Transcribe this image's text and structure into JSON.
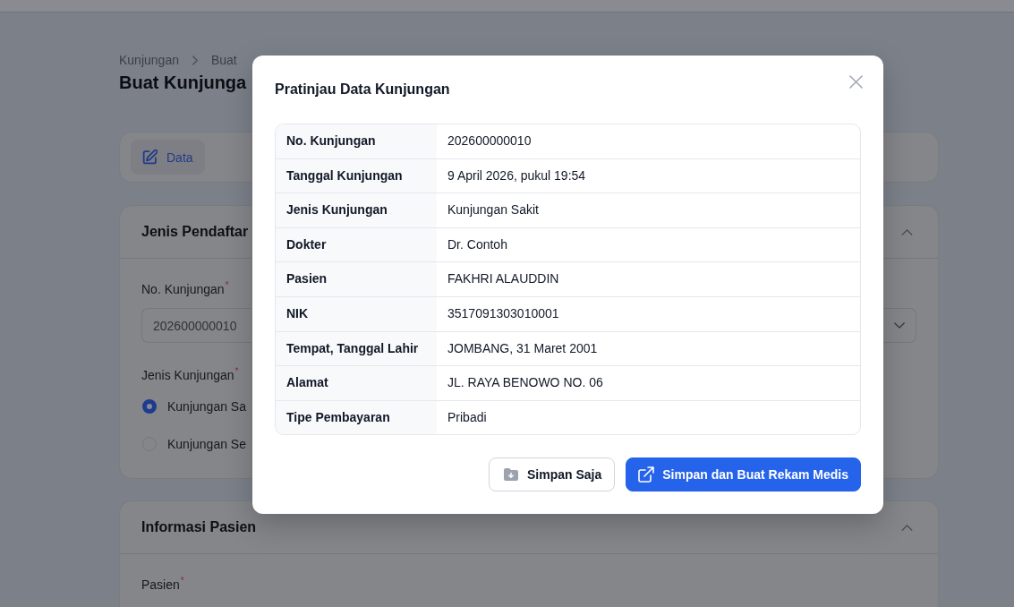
{
  "breadcrumb": [
    {
      "label": "Kunjungan"
    },
    {
      "label": "Buat"
    }
  ],
  "page_title": "Buat Kunjunga",
  "tabs": [
    {
      "label": "Data",
      "selected": true
    }
  ],
  "sections": [
    {
      "title": "Jenis Pendaftar",
      "expanded": true,
      "fields": [
        {
          "kind": "text",
          "label": "No. Kunjungan",
          "required_mark": "*",
          "value": "202600000010"
        },
        {
          "kind": "select"
        },
        {
          "kind": "radio",
          "label": "Jenis Kunjungan",
          "required_mark": "*",
          "options": [
            {
              "label": "Kunjungan Sa",
              "selected": true
            },
            {
              "label": "Kunjungan Se",
              "selected": false
            }
          ]
        }
      ]
    },
    {
      "title": "Informasi Pasien",
      "expanded": true,
      "fields": [
        {
          "kind": "label",
          "label": "Pasien",
          "required_mark": "*"
        }
      ]
    }
  ],
  "modal": {
    "title": "Pratinjau Data Kunjungan",
    "rows": [
      {
        "label": "No. Kunjungan",
        "value": "202600000010"
      },
      {
        "label": "Tanggal Kunjungan",
        "value": "9 April 2026, pukul 19:54"
      },
      {
        "label": "Jenis Kunjungan",
        "value": "Kunjungan Sakit"
      },
      {
        "label": "Dokter",
        "value": "Dr. Contoh"
      },
      {
        "label": "Pasien",
        "value": "FAKHRI ALAUDDIN"
      },
      {
        "label": "NIK",
        "value": "3517091303010001"
      },
      {
        "label": "Tempat, Tanggal Lahir",
        "value": "JOMBANG, 31 Maret 2001"
      },
      {
        "label": "Alamat",
        "value": "JL. RAYA BENOWO NO. 06"
      },
      {
        "label": "Tipe Pembayaran",
        "value": "Pribadi"
      }
    ],
    "buttons": [
      {
        "label": "Simpan Saja",
        "kind": "secondary"
      },
      {
        "label": "Simpan dan Buat Rekam Medis",
        "kind": "primary"
      }
    ]
  }
}
